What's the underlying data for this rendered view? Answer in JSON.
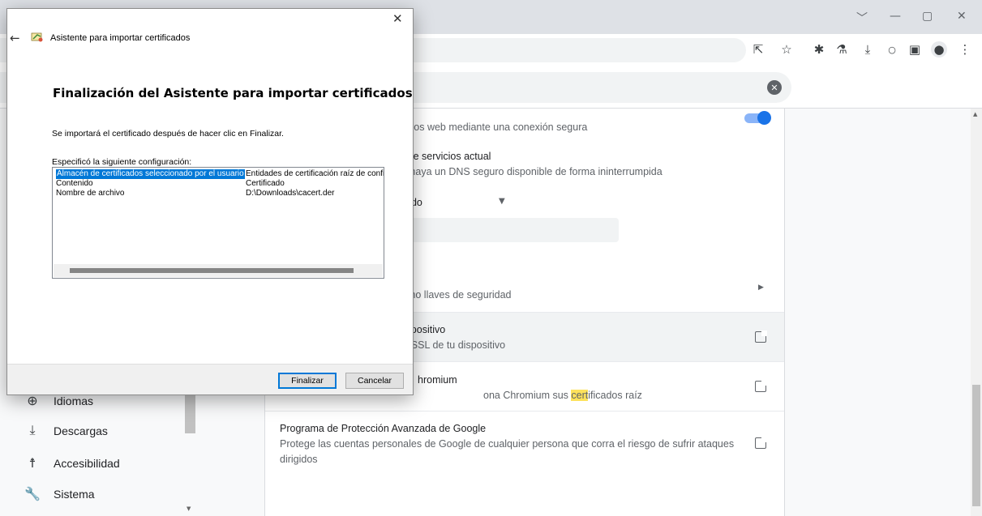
{
  "browser": {
    "window_controls": [
      "﹀",
      "—",
      "▢",
      "✕"
    ],
    "toolbar_icons": [
      "share-icon",
      "star-icon",
      "extensions-icon",
      "labs-icon",
      "download-icon",
      "zoom-icon",
      "sidepanel-icon",
      "profile-icon",
      "menu-icon"
    ],
    "search_clear": "✕"
  },
  "settings": {
    "rows": {
      "secure_connection_text": "sitios web mediante una conexión segura",
      "dns_title": "r de servicios actual",
      "dns_desc": "o haya un DNS seguro disponible de forma ininterrumpida",
      "dropdown_value": "ado",
      "keys_text": "omo llaves de seguridad",
      "device_title": "lispositivo",
      "device_desc": "S/SSL de tu dispositivo",
      "chromium_title": "hromium",
      "chromium_desc_prefix": "ona Chromium sus ",
      "chromium_desc_mark": "cert",
      "chromium_desc_suffix": "ificados raíz",
      "google_title": "Programa de Protección Avanzada de Google",
      "google_desc_line1": "Protege las cuentas personales de Google de cualquier persona que corra el riesgo de sufrir ataques",
      "google_desc_line2": "dirigidos"
    },
    "sidebar": [
      {
        "label": "Idiomas",
        "icon": "globe-icon"
      },
      {
        "label": "Descargas",
        "icon": "download-icon"
      },
      {
        "label": "Accesibilidad",
        "icon": "accessibility-icon"
      },
      {
        "label": "Sistema",
        "icon": "wrench-icon"
      }
    ]
  },
  "dialog": {
    "title": "Asistente para importar certificados",
    "heading": "Finalización del Asistente para importar certificados",
    "intro": "Se importará el certificado después de hacer clic en Finalizar.",
    "config_label": "Especificó la siguiente configuración:",
    "rows": [
      {
        "key": "Almacén de certificados seleccionado por el usuario",
        "value": "Entidades de certificación raíz de confi"
      },
      {
        "key": "Contenido",
        "value": "Certificado"
      },
      {
        "key": "Nombre de archivo",
        "value": "D:\\Downloads\\cacert.der"
      }
    ],
    "finish_button": "Finalizar",
    "cancel_button": "Cancelar"
  }
}
